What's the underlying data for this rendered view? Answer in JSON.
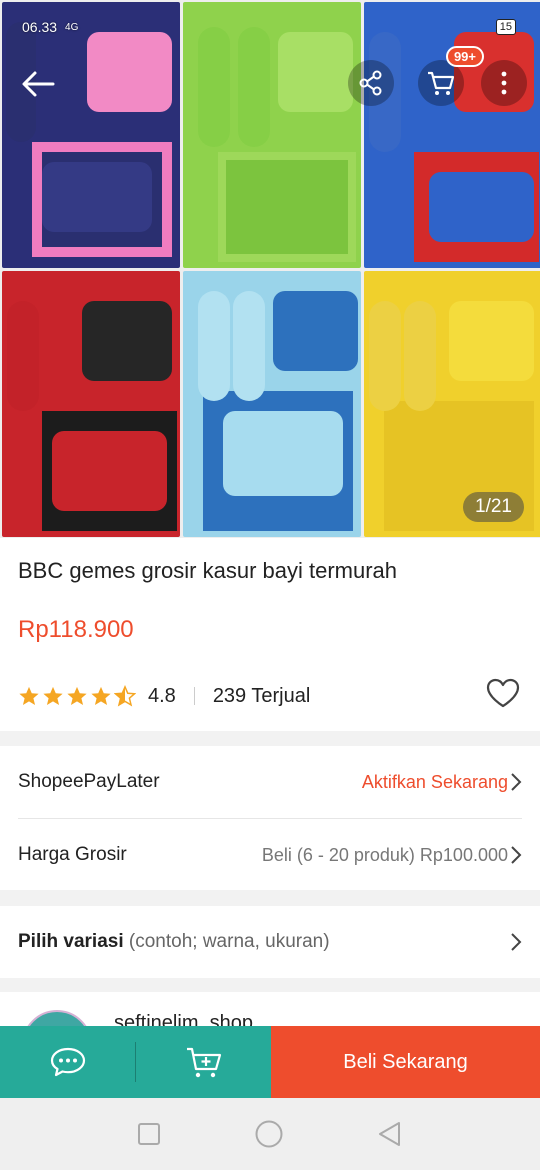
{
  "status_bar": {
    "time": "06.33",
    "network": "4G",
    "battery": "15"
  },
  "gallery": {
    "counter": "1/21",
    "cart_badge": "99+"
  },
  "product": {
    "title": "BBC gemes grosir kasur bayi termurah",
    "price": "Rp118.900",
    "rating": "4.8",
    "rating_stars": 4.5,
    "sold": "239 Terjual"
  },
  "rows": {
    "paylater_label": "ShopeePayLater",
    "paylater_value": "Aktifkan Sekarang",
    "grosir_label": "Harga Grosir",
    "grosir_value": "Beli (6 - 20 produk) Rp100.000",
    "variasi_label": "Pilih variasi",
    "variasi_hint": "(contoh; warna, ukuran)"
  },
  "seller": {
    "name": "seftinelim_shop"
  },
  "bottom_bar": {
    "buy_label": "Beli Sekarang"
  },
  "colors": {
    "accent": "#ee4d2d",
    "teal": "#26aa99"
  },
  "icons": [
    "back-arrow-icon",
    "share-icon",
    "cart-icon",
    "more-icon",
    "star-icon",
    "heart-icon",
    "chevron-right-icon",
    "chat-icon",
    "add-to-cart-icon",
    "nav-square-icon",
    "nav-circle-icon",
    "nav-back-icon"
  ]
}
